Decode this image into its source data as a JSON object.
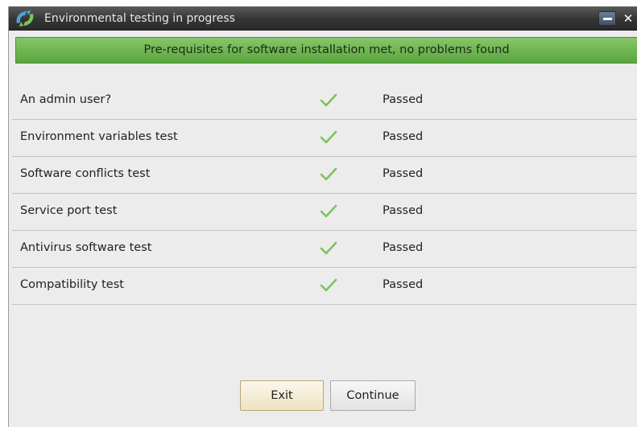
{
  "window": {
    "title": "Environmental testing in progress",
    "close_glyph": "✕"
  },
  "banner": {
    "message": "Pre-requisites for software installation met, no problems found",
    "color": "#6db54f"
  },
  "checks": [
    {
      "label": "An admin user?",
      "status": "Passed",
      "icon": "check-icon"
    },
    {
      "label": "Environment variables test",
      "status": "Passed",
      "icon": "check-icon"
    },
    {
      "label": "Software conflicts test",
      "status": "Passed",
      "icon": "check-icon"
    },
    {
      "label": "Service port test",
      "status": "Passed",
      "icon": "check-icon"
    },
    {
      "label": "Antivirus software test",
      "status": "Passed",
      "icon": "check-icon"
    },
    {
      "label": "Compatibility test",
      "status": "Passed",
      "icon": "check-icon"
    }
  ],
  "check_color": "#7cc45c",
  "buttons": {
    "exit": "Exit",
    "continue": "Continue"
  }
}
